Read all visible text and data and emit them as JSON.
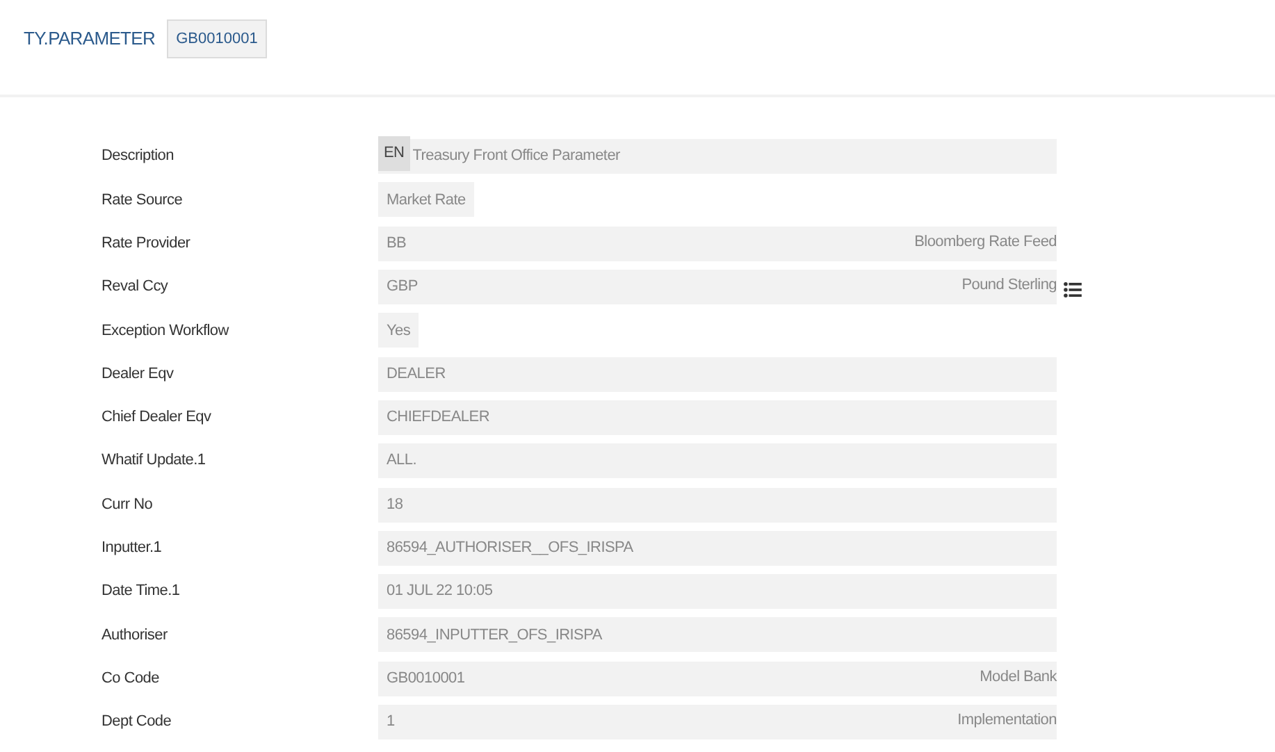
{
  "header": {
    "title": "TY.PARAMETER",
    "record_id": "GB0010001"
  },
  "fields": [
    {
      "label": "Description",
      "kind": "full",
      "lang": "EN",
      "value": "Treasury Front Office Parameter",
      "lookup": false
    },
    {
      "label": "Rate Source",
      "kind": "short",
      "value": "Market Rate",
      "lookup": false
    },
    {
      "label": "Rate Provider",
      "kind": "full",
      "value": "BB",
      "enrichment": "Bloomberg Rate Feed",
      "lookup": false
    },
    {
      "label": "Reval Ccy",
      "kind": "full",
      "value": "GBP",
      "enrichment": "Pound Sterling",
      "lookup": true
    },
    {
      "label": "Exception Workflow",
      "kind": "short",
      "value": "Yes",
      "lookup": false
    },
    {
      "label": "Dealer Eqv",
      "kind": "full",
      "value": "DEALER",
      "lookup": false
    },
    {
      "label": "Chief Dealer Eqv",
      "kind": "full",
      "value": "CHIEFDEALER",
      "lookup": false
    },
    {
      "label": "Whatif Update.1",
      "kind": "full",
      "value": "ALL.",
      "lookup": false
    },
    {
      "label": "Curr No",
      "kind": "full",
      "value": "18",
      "lookup": false
    },
    {
      "label": "Inputter.1",
      "kind": "full",
      "value": "86594_AUTHORISER__OFS_IRISPA",
      "lookup": false
    },
    {
      "label": "Date Time.1",
      "kind": "full",
      "value": "01 JUL 22 10:05",
      "lookup": false
    },
    {
      "label": "Authoriser",
      "kind": "full",
      "value": "86594_INPUTTER_OFS_IRISPA",
      "lookup": false
    },
    {
      "label": "Co Code",
      "kind": "full",
      "value": "GB0010001",
      "enrichment": "Model Bank",
      "lookup": false
    },
    {
      "label": "Dept Code",
      "kind": "full",
      "value": "1",
      "enrichment": "Implementation",
      "lookup": false
    }
  ]
}
